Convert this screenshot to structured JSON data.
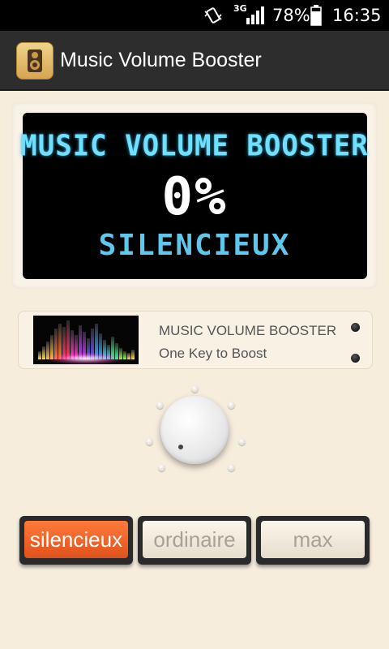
{
  "status_bar": {
    "network_type": "3G",
    "battery_percent": "78%",
    "time": "16:35",
    "icons": [
      "vibrate-icon",
      "signal-icon",
      "battery-icon"
    ]
  },
  "action_bar": {
    "title": "Music Volume Booster",
    "icon": "speaker-app-icon"
  },
  "display": {
    "title": "MUSIC VOLUME BOOSTER",
    "percent": "0%",
    "mode": "SILENCIEUX"
  },
  "info": {
    "title": "MUSIC VOLUME BOOSTER",
    "subtitle": "One Key to Boost"
  },
  "knob": {
    "level": 0
  },
  "modes": {
    "silent": "silencieux",
    "ordinary": "ordinaire",
    "max": "max",
    "active": "silent"
  },
  "colors": {
    "lcd_cyan": "#6fe0ff",
    "active_button": "#e0521c",
    "background": "#f6eddd"
  }
}
